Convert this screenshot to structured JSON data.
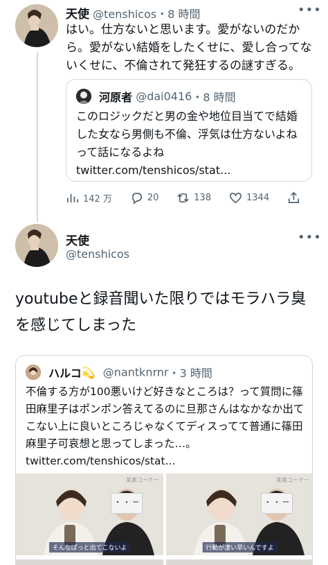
{
  "tweet1": {
    "name": "天使",
    "handle": "@tenshicos",
    "time": "・8 時間",
    "more": "•••",
    "text": "はい。仕方ないと思います。愛がないのだから。愛がない結婚をしたくせに、愛し合ってないくせに、不倫されて発狂するの謎すぎる。",
    "quote": {
      "name": "河原者",
      "handle": "@dai0416",
      "time": "・8 時間",
      "text": "このロジックだと男の金や地位目当てで結婚した女なら男側も不倫、浮気は仕方ないよねって話になるよね twitter.com/tenshicos/stat..."
    },
    "actions": {
      "views": "142 万",
      "replies": "20",
      "retweets": "138",
      "likes": "1344"
    }
  },
  "tweet2": {
    "name": "天使",
    "handle": "@tenshicos",
    "more": "•••",
    "text": "youtubeと録音聞いた限りではモラハラ臭を感じてしまった",
    "quote": {
      "name": "ハルコ",
      "emoji": "💫",
      "handle": "@nantknrnr",
      "time": "・3 時間",
      "text": "不倫する方が100悪いけど好きなところは？って質問に篠田麻里子はポンポン答えてるのに旦那さんはなかなか出てこない上に良いところじゃなくてディスってて普通に篠田麻里子可哀想と思ってしまった…。 twitter.com/tenshicos/stat...",
      "media": [
        {
          "badge": "某奥コーナー",
          "caption": "そんなぱっと出てこないよ",
          "face": "・ ・\n ー"
        },
        {
          "badge": "某奥コーナー",
          "caption": "行動が凄い早いんですよ",
          "face": "・ ・\n ー"
        }
      ]
    }
  }
}
